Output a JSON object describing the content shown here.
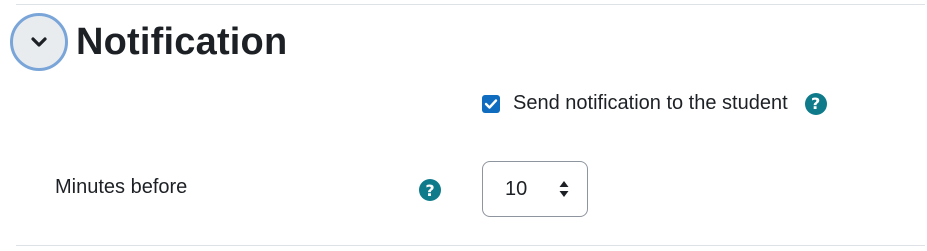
{
  "section": {
    "title": "Notification",
    "toggle_icon": "chevron-down-icon"
  },
  "notify_student": {
    "label": "Send notification to the student",
    "checked": true,
    "help_icon": "question-circle-icon"
  },
  "minutes_before": {
    "label": "Minutes before",
    "value": "10",
    "help_icon": "question-circle-icon",
    "select_icon": "up-down-caret-icon"
  },
  "colors": {
    "accent": "#0f6cbf",
    "help": "#0f7a8a",
    "toggle_ring": "#7aa5d9"
  }
}
